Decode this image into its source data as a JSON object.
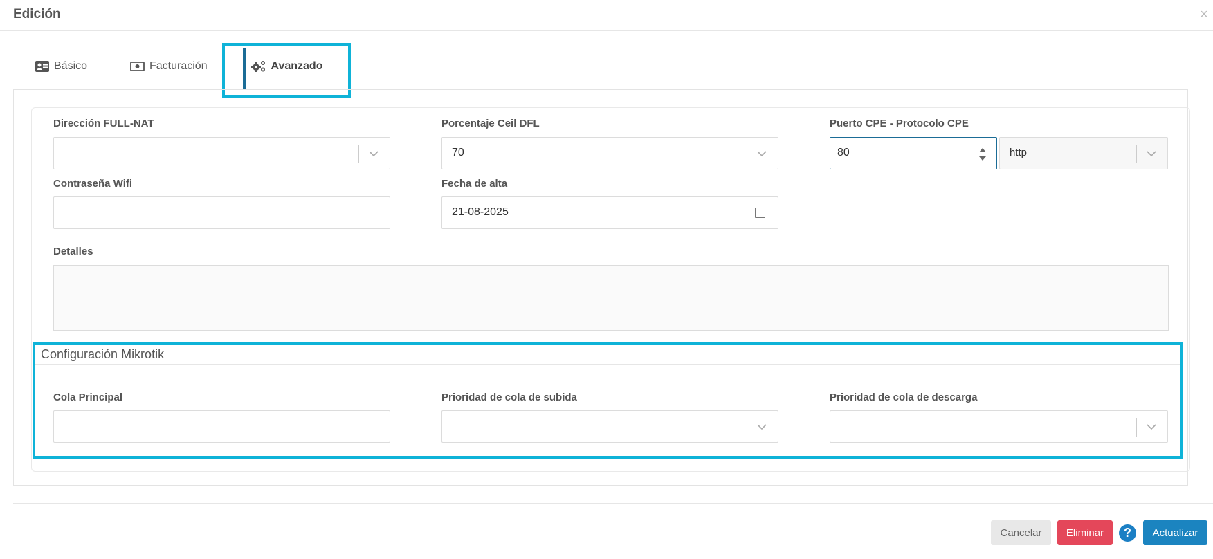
{
  "modal": {
    "title": "Edición",
    "close_icon": "×"
  },
  "tabs": [
    {
      "label": "Básico",
      "icon": "id-card-icon"
    },
    {
      "label": "Facturación",
      "icon": "money-bill-icon"
    },
    {
      "label": "Avanzado",
      "icon": "cogs-icon",
      "active": true
    }
  ],
  "form": {
    "full_nat": {
      "label": "Dirección FULL-NAT",
      "value": ""
    },
    "ceil_dfl": {
      "label": "Porcentaje Ceil DFL",
      "value": "70"
    },
    "cpe": {
      "label": "Puerto CPE - Protocolo CPE",
      "port": "80",
      "protocol": "http"
    },
    "wifi_password": {
      "label": "Contraseña Wifi",
      "value": ""
    },
    "fecha_alta": {
      "label": "Fecha de alta",
      "value": "21-08-2025"
    },
    "detalles": {
      "label": "Detalles",
      "value": ""
    }
  },
  "mikrotik": {
    "title": "Configuración Mikrotik",
    "cola_principal": {
      "label": "Cola Principal",
      "value": ""
    },
    "prioridad_subida": {
      "label": "Prioridad de cola de subida",
      "value": ""
    },
    "prioridad_descarga": {
      "label": "Prioridad de cola de descarga",
      "value": ""
    }
  },
  "footer": {
    "cancel": "Cancelar",
    "delete": "Eliminar",
    "help": "?",
    "update": "Actualizar"
  },
  "colors": {
    "accent": "#1b84c0",
    "danger": "#e4475a",
    "highlight": "#0fb3d8"
  }
}
